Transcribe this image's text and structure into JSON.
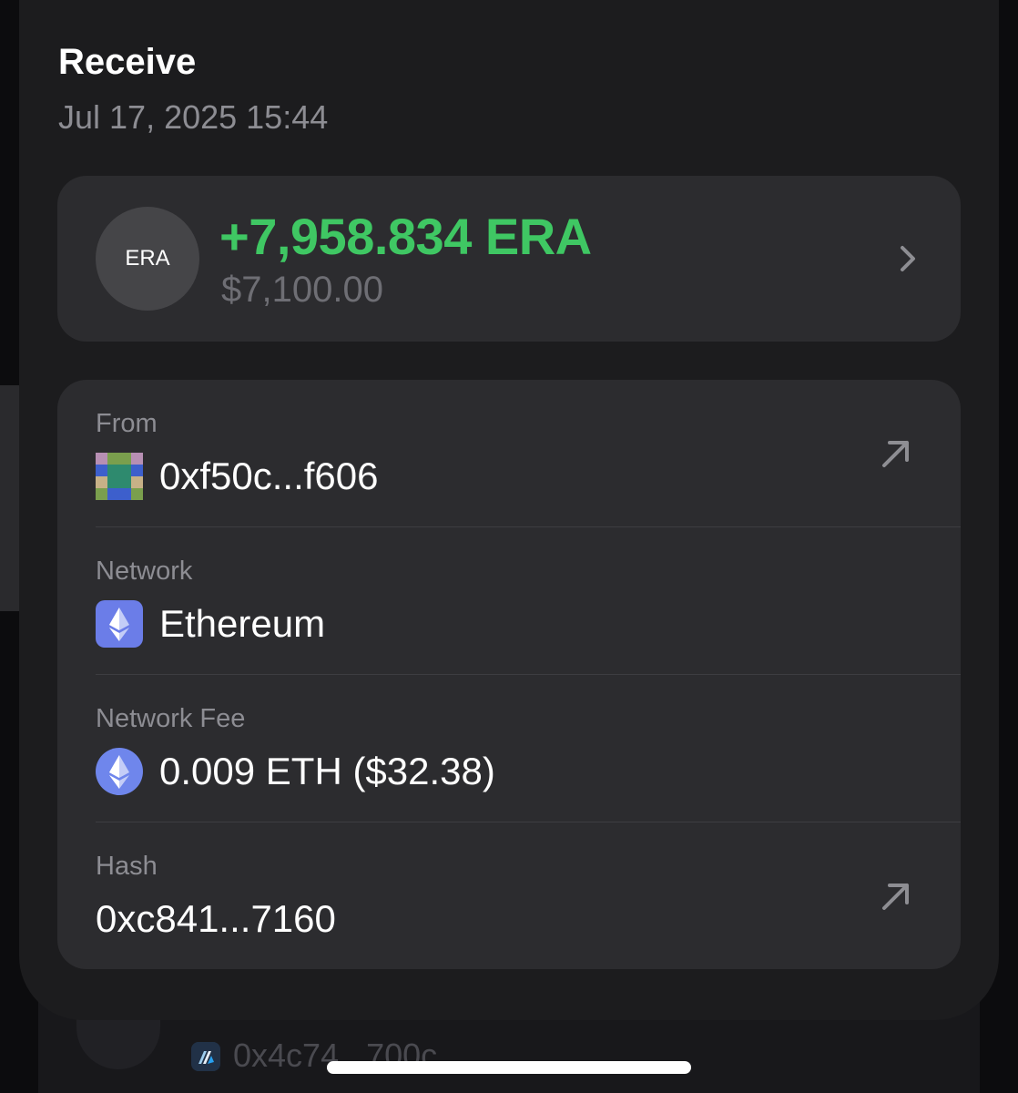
{
  "transaction": {
    "title": "Receive",
    "date": "Jul 17, 2025 15:44"
  },
  "amount_card": {
    "token_symbol": "ERA",
    "amount": "+7,958.834 ERA",
    "usd_value": "$7,100.00",
    "amount_color": "#3fc763"
  },
  "details": {
    "from": {
      "label": "From",
      "value": "0xf50c...f606",
      "icon": "wallet-identicon"
    },
    "network": {
      "label": "Network",
      "value": "Ethereum",
      "icon": "ethereum-icon"
    },
    "network_fee": {
      "label": "Network Fee",
      "value": "0.009 ETH ($32.38)",
      "icon": "ethereum-icon"
    },
    "hash": {
      "label": "Hash",
      "value": "0xc841...7160"
    }
  },
  "background_list": {
    "address": "0x4c74...700c",
    "icon": "arbitrum-icon"
  },
  "colors": {
    "ethereum_square": "#6b7de8",
    "ethereum_circle": "#6f86ec"
  }
}
